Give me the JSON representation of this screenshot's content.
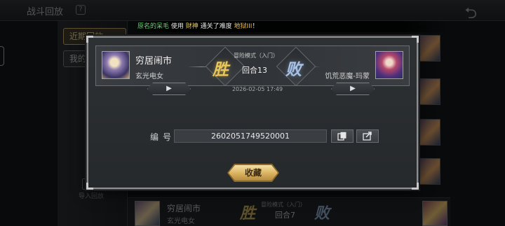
{
  "screen": {
    "title": "战斗回放",
    "help_glyph": "?",
    "back_glyph": "⮌"
  },
  "announcement": {
    "player": "原名的呆毛",
    "text1": " 使用 ",
    "hero": "财神",
    "text2": " 通关了难度 ",
    "difficulty": "地狱III",
    "text3": "！"
  },
  "left_panel": {
    "tabs": [
      {
        "label": "近期回放",
        "active": true
      },
      {
        "label": "我的收藏",
        "active": false
      }
    ],
    "import_label": "导入回放"
  },
  "background_rows": [
    {
      "name": "穷居闹市",
      "title": "玄光电女",
      "result_win": "胜",
      "mode": "冒险模式（入门）",
      "round": "回合7",
      "result_lose": "败"
    }
  ],
  "modal": {
    "player_name": "穷居闹市",
    "player_title": "玄光电女",
    "opponent_title": "饥荒恶魔-玛蒙",
    "win_glyph": "胜",
    "lose_glyph": "败",
    "mode": "冒险模式（入门）",
    "round": "回合13",
    "datetime": "2026-02-05 17:49",
    "play_glyph": "▶",
    "code_label": "编号",
    "code_value": "2602051749520001",
    "favorite_label": "收藏"
  },
  "colors": {
    "win": "#e9c65a",
    "lose": "#a7c2e6",
    "favorite_button": "#d9b25e",
    "announce_name": "#5fd86a",
    "announce_hero": "#f0d15a"
  }
}
